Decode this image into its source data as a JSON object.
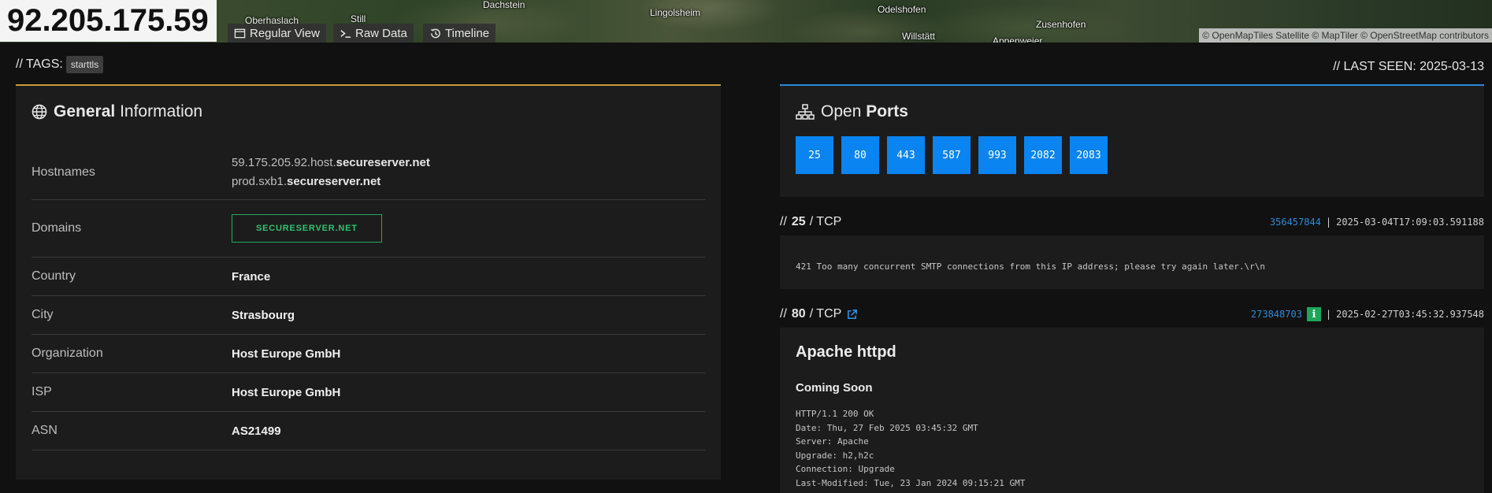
{
  "map": {
    "labels": [
      "Oberhaslach",
      "Still",
      "Dachstein",
      "Lingolsheim",
      "Odelshofen",
      "Zusenhofen",
      "Willstätt",
      "Appenweier"
    ],
    "attribution": "© OpenMapTiles Satellite  © MapTiler © OpenStreetMap contributors"
  },
  "header": {
    "ip": "92.205.175.59",
    "views": [
      "Regular View",
      "Raw Data",
      "Timeline"
    ]
  },
  "tags": {
    "label": "// TAGS:",
    "items": [
      "starttls"
    ]
  },
  "last_seen": "// LAST SEEN: 2025-03-13",
  "general": {
    "title_bold": "General",
    "title_rest": "Information",
    "hostnames_label": "Hostnames",
    "hostnames": [
      {
        "prefix": "59.175.205.92.host.",
        "domain": "secureserver.net"
      },
      {
        "prefix": "prod.sxb1.",
        "domain": "secureserver.net"
      }
    ],
    "domains_label": "Domains",
    "domain": "SECURESERVER.NET",
    "country_label": "Country",
    "country": "France",
    "city_label": "City",
    "city": "Strasbourg",
    "org_label": "Organization",
    "org": "Host Europe GmbH",
    "isp_label": "ISP",
    "isp": "Host Europe GmbH",
    "asn_label": "ASN",
    "asn": "AS21499"
  },
  "ports": {
    "title_rest": "Open",
    "title_bold": "Ports",
    "list": [
      "25",
      "80",
      "443",
      "587",
      "993",
      "2082",
      "2083"
    ]
  },
  "services": [
    {
      "prefix": "//",
      "port": "25",
      "proto": "/ TCP",
      "hash": "356457844",
      "timestamp": "2025-03-04T17:09:03.591188",
      "banner": "421 Too many concurrent SMTP connections from this IP address; please try again later.\\r\\n"
    },
    {
      "prefix": "//",
      "port": "80",
      "proto": "/ TCP",
      "hash": "273848703",
      "info": "i",
      "timestamp": "2025-02-27T03:45:32.937548",
      "title": "Apache httpd",
      "subtitle": "Coming Soon",
      "headers": [
        "HTTP/1.1 200 OK",
        "Date: Thu, 27 Feb 2025 03:45:32 GMT",
        "Server: Apache",
        "Upgrade: h2,h2c",
        "Connection: Upgrade",
        "Last-Modified: Tue, 23 Jan 2024 09:15:21 GMT"
      ]
    }
  ],
  "separator": "|"
}
